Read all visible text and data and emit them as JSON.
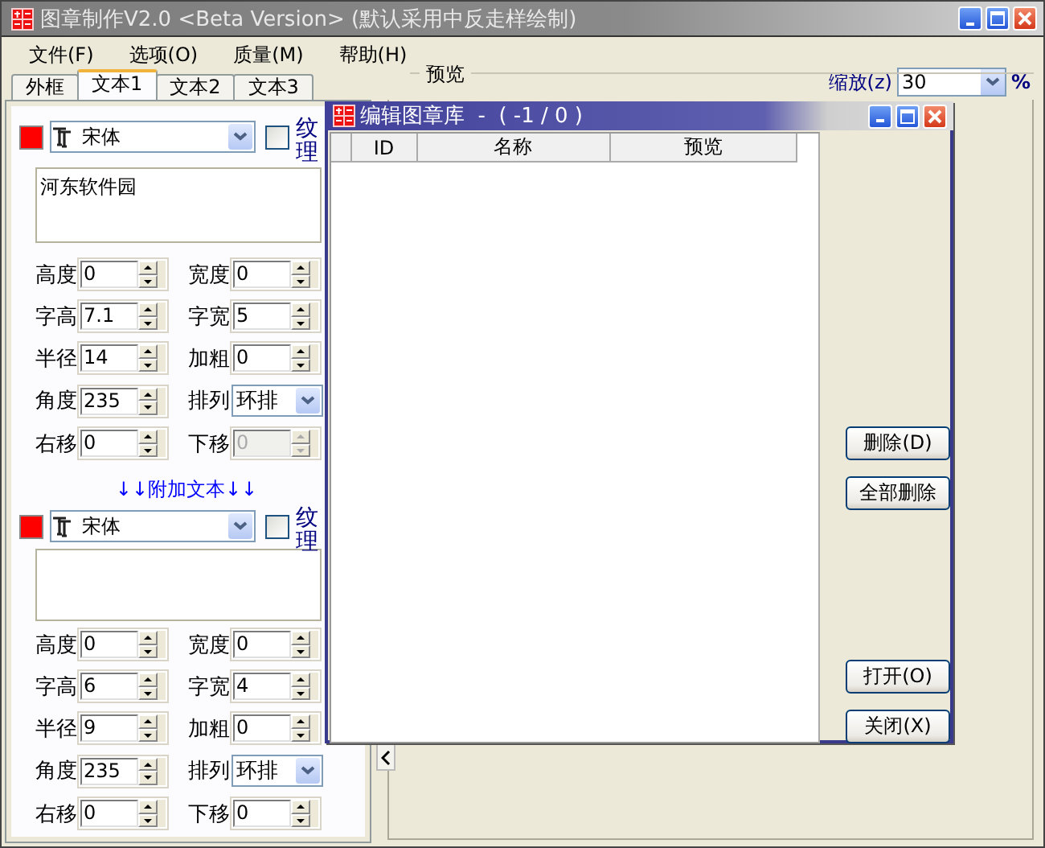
{
  "window": {
    "title": "图章制作V2.0 <Beta Version> (默认采用中反走样绘制)"
  },
  "menu": [
    "文件(F)",
    "选项(O)",
    "质量(M)",
    "帮助(H)"
  ],
  "tabs": [
    {
      "label": "外框",
      "selected": false
    },
    {
      "label": "文本1",
      "selected": true
    },
    {
      "label": "文本2",
      "selected": false
    },
    {
      "label": "文本3",
      "selected": false
    }
  ],
  "sections": [
    {
      "color": "#ff0000",
      "font": "宋体",
      "texture": {
        "label": "纹理",
        "checked": false
      },
      "text": "河东软件园",
      "fields": [
        {
          "label": "高度",
          "value": "0",
          "kind": "spin",
          "disabled": false
        },
        {
          "label": "宽度",
          "value": "0",
          "kind": "spin",
          "disabled": false
        },
        {
          "label": "字高",
          "value": "7.1",
          "kind": "spin",
          "disabled": false
        },
        {
          "label": "字宽",
          "value": "5",
          "kind": "spin",
          "disabled": false
        },
        {
          "label": "半径",
          "value": "14",
          "kind": "spin",
          "disabled": false
        },
        {
          "label": "加粗",
          "value": "0",
          "kind": "spin",
          "disabled": false
        },
        {
          "label": "角度",
          "value": "235",
          "kind": "spin",
          "disabled": false
        },
        {
          "label": "排列",
          "value": "环排",
          "kind": "combo",
          "disabled": false
        },
        {
          "label": "右移",
          "value": "0",
          "kind": "spin",
          "disabled": false
        },
        {
          "label": "下移",
          "value": "0",
          "kind": "spin",
          "disabled": true
        }
      ]
    },
    {
      "color": "#ff0000",
      "font": "宋体",
      "texture": {
        "label": "纹理",
        "checked": false
      },
      "fields": [
        {
          "label": "高度",
          "value": "0",
          "kind": "spin",
          "disabled": false
        },
        {
          "label": "宽度",
          "value": "0",
          "kind": "spin",
          "disabled": false
        },
        {
          "label": "字高",
          "value": "6",
          "kind": "spin",
          "disabled": false
        },
        {
          "label": "字宽",
          "value": "4",
          "kind": "spin",
          "disabled": false
        },
        {
          "label": "半径",
          "value": "9",
          "kind": "spin",
          "disabled": false
        },
        {
          "label": "加粗",
          "value": "0",
          "kind": "spin",
          "disabled": false
        },
        {
          "label": "角度",
          "value": "235",
          "kind": "spin",
          "disabled": false
        },
        {
          "label": "排列",
          "value": "环排",
          "kind": "combo",
          "disabled": false
        },
        {
          "label": "右移",
          "value": "0",
          "kind": "spin",
          "disabled": false
        },
        {
          "label": "下移",
          "value": "0",
          "kind": "spin",
          "disabled": false
        }
      ]
    }
  ],
  "extra_text_heading": "↓↓附加文本↓↓",
  "preview": {
    "label": "预览",
    "zoom_label": "缩放(z)",
    "zoom_value": "30",
    "zoom_unit": "%"
  },
  "dialog": {
    "title": "编辑图章库  -  ( -1 / 0 )",
    "columns": [
      "",
      "ID",
      "名称",
      "预览"
    ],
    "buttons": [
      "删除(D)",
      "全部删除",
      "打开(O)",
      "关闭(X)"
    ]
  }
}
